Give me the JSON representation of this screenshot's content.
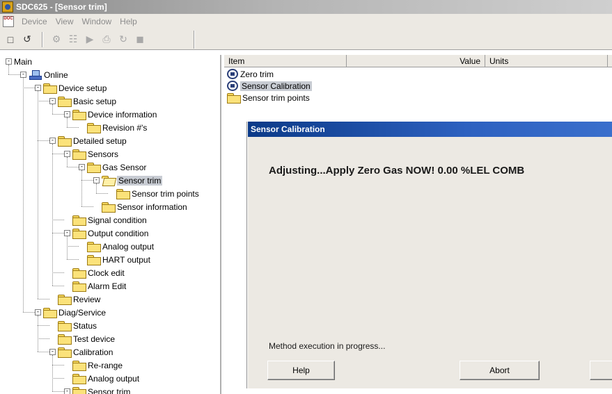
{
  "window": {
    "title": "SDC625 - [Sensor trim]"
  },
  "menubar": {
    "items": [
      "Device",
      "View",
      "Window",
      "Help"
    ]
  },
  "toolbar": {
    "buttons": [
      {
        "icon": "new-document-icon",
        "enabled": true
      },
      {
        "icon": "online-icon",
        "enabled": true
      },
      {
        "icon": "device-icon",
        "enabled": false
      },
      {
        "icon": "multi-device-icon",
        "enabled": false
      },
      {
        "icon": "method-run-icon",
        "enabled": false
      },
      {
        "icon": "print-icon",
        "enabled": false
      },
      {
        "icon": "refresh-icon",
        "enabled": false
      },
      {
        "icon": "stop-icon",
        "enabled": false
      }
    ]
  },
  "tree": {
    "nodes": [
      {
        "label": "Main",
        "expander": "-",
        "icon": "none"
      },
      {
        "label": "Online",
        "expander": "-",
        "icon": "network"
      },
      {
        "label": "Device setup",
        "expander": "-",
        "icon": "folder"
      },
      {
        "label": "Basic setup",
        "expander": "-",
        "icon": "folder"
      },
      {
        "label": "Device information",
        "expander": "-",
        "icon": "folder"
      },
      {
        "label": "Revision #'s",
        "expander": "",
        "icon": "folder"
      },
      {
        "label": "Detailed setup",
        "expander": "-",
        "icon": "folder"
      },
      {
        "label": "Sensors",
        "expander": "-",
        "icon": "folder"
      },
      {
        "label": "Gas Sensor",
        "expander": "-",
        "icon": "folder"
      },
      {
        "label": "Sensor trim",
        "expander": "-",
        "icon": "open-folder",
        "selected": true
      },
      {
        "label": "Sensor trim points",
        "expander": "",
        "icon": "folder"
      },
      {
        "label": "Sensor information",
        "expander": "",
        "icon": "folder"
      },
      {
        "label": "Signal condition",
        "expander": "",
        "icon": "folder"
      },
      {
        "label": "Output condition",
        "expander": "-",
        "icon": "folder"
      },
      {
        "label": "Analog output",
        "expander": "",
        "icon": "folder"
      },
      {
        "label": "HART output",
        "expander": "",
        "icon": "folder"
      },
      {
        "label": "Clock edit",
        "expander": "",
        "icon": "folder"
      },
      {
        "label": "Alarm Edit",
        "expander": "",
        "icon": "folder"
      },
      {
        "label": "Review",
        "expander": "",
        "icon": "folder"
      },
      {
        "label": "Diag/Service",
        "expander": "-",
        "icon": "folder"
      },
      {
        "label": "Status",
        "expander": "",
        "icon": "folder"
      },
      {
        "label": "Test device",
        "expander": "",
        "icon": "folder"
      },
      {
        "label": "Calibration",
        "expander": "-",
        "icon": "folder"
      },
      {
        "label": "Re-range",
        "expander": "",
        "icon": "folder"
      },
      {
        "label": "Analog output",
        "expander": "",
        "icon": "folder"
      },
      {
        "label": "Sensor trim",
        "expander": "-",
        "icon": "folder"
      }
    ]
  },
  "list": {
    "columns": [
      "Item",
      "Value",
      "Units"
    ],
    "rows": [
      {
        "label": "Zero trim",
        "icon": "method",
        "selected": false
      },
      {
        "label": "Sensor Calibration",
        "icon": "method",
        "selected": true
      },
      {
        "label": "Sensor trim points",
        "icon": "folder",
        "selected": false
      }
    ]
  },
  "dialog": {
    "title": "Sensor Calibration",
    "message": "Adjusting...Apply Zero Gas NOW!  0.00 %LEL  COMB",
    "status": "Method execution in progress...",
    "help_label": "Help",
    "abort_label": "Abort",
    "extra_label": ""
  },
  "colors": {
    "dialog_title_bar": "#0b3a88",
    "selection": "#c8ccd3",
    "folder": "#fbe27a",
    "chrome": "#ece9e3"
  }
}
